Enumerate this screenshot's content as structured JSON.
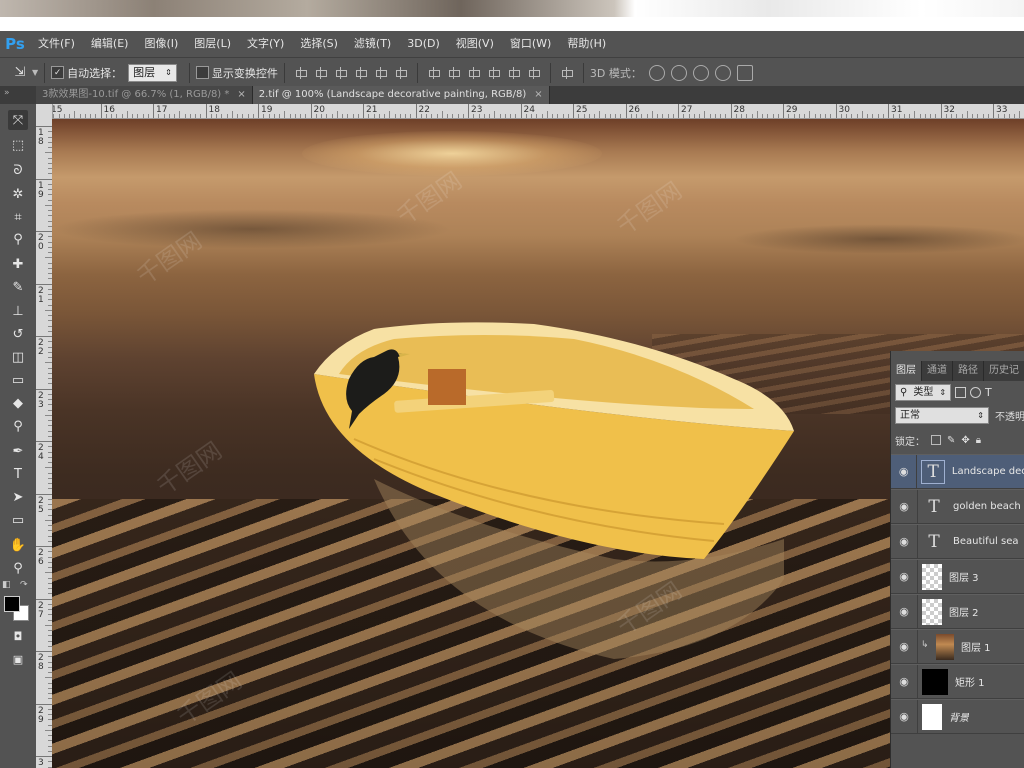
{
  "app": {
    "logo": "Ps"
  },
  "menu": [
    "文件(F)",
    "编辑(E)",
    "图像(I)",
    "图层(L)",
    "文字(Y)",
    "选择(S)",
    "滤镜(T)",
    "3D(D)",
    "视图(V)",
    "窗口(W)",
    "帮助(H)"
  ],
  "options": {
    "auto_select_label": "自动选择：",
    "auto_select_value": "图层",
    "show_transform_label": "显示变换控件",
    "mode_3d_label": "3D 模式："
  },
  "tabs": [
    {
      "label": "3款效果图-10.tif @ 66.7% (1, RGB/8) *",
      "close": "×",
      "active": false
    },
    {
      "label": "2.tif @ 100% (Landscape decorative painting, RGB/8)",
      "close": "×",
      "active": true
    }
  ],
  "ruler_h": [
    "15",
    "16",
    "17",
    "18",
    "19",
    "20",
    "21",
    "22",
    "23",
    "24",
    "25",
    "26",
    "27",
    "28",
    "29",
    "30",
    "31",
    "32",
    "33"
  ],
  "ruler_v": [
    "1\n8",
    "1\n9",
    "2\n0",
    "2\n1",
    "2\n2",
    "2\n3",
    "2\n4",
    "2\n5",
    "2\n6",
    "2\n7",
    "2\n8",
    "2\n9",
    "3"
  ],
  "tools": [
    "move-tool",
    "marquee-tool",
    "lasso-tool",
    "magic-wand-tool",
    "crop-tool",
    "eyedropper-tool",
    "healing-brush-tool",
    "brush-tool",
    "clone-stamp-tool",
    "history-brush-tool",
    "eraser-tool",
    "gradient-tool",
    "blur-tool",
    "dodge-tool",
    "pen-tool",
    "type-tool",
    "path-selection-tool",
    "shape-tool",
    "hand-tool",
    "zoom-tool"
  ],
  "tool_glyphs": {
    "type": "T"
  },
  "watermark": "千图网",
  "layers_panel": {
    "tabs": [
      "图层",
      "通道",
      "路径",
      "历史记"
    ],
    "filter_label": "类型",
    "blend_mode": "正常",
    "opacity_label": "不透明",
    "lock_label": "锁定：",
    "layers": [
      {
        "name": "Landscape dec",
        "kind": "text",
        "selected": true
      },
      {
        "name": "golden beach",
        "kind": "text",
        "selected": false
      },
      {
        "name": "Beautiful sea",
        "kind": "text",
        "selected": false
      },
      {
        "name": "图层 3",
        "kind": "checker",
        "selected": false
      },
      {
        "name": "图层 2",
        "kind": "checker",
        "selected": false
      },
      {
        "name": "图层 1",
        "kind": "image",
        "selected": false,
        "clipped": true
      },
      {
        "name": "矩形 1",
        "kind": "black",
        "selected": false
      },
      {
        "name": "背景",
        "kind": "white",
        "selected": false,
        "italic": true
      }
    ]
  },
  "colors": {
    "accent": "#32a0f0",
    "panel": "#535353",
    "dark": "#3c3c3c",
    "boat": "#f2c443"
  }
}
